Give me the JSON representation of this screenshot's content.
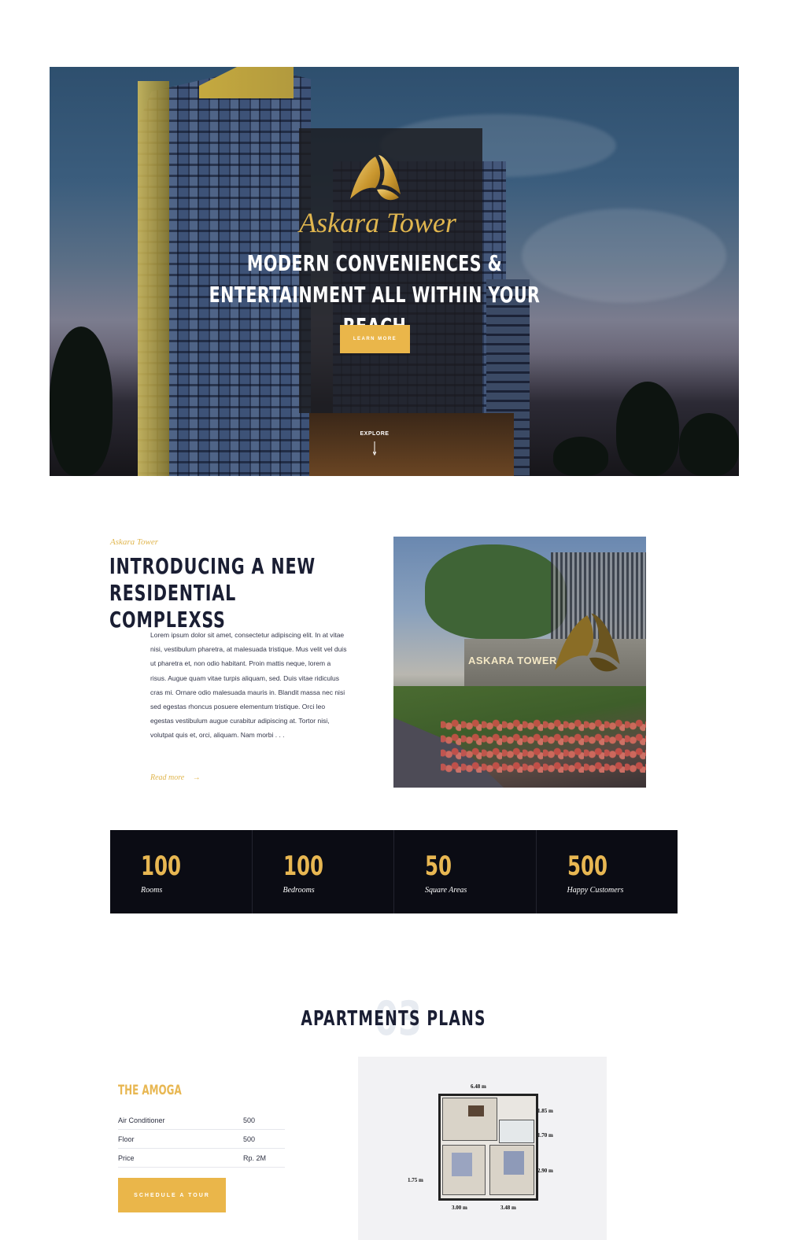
{
  "hero": {
    "brand": "Askara Tower",
    "headline": "MODERN CONVENIENCES & ENTERTAINMENT ALL WITHIN YOUR REACH",
    "cta_label": "LEARN MORE",
    "explore_label": "EXPLORE",
    "explore_icon": "arrow-down-icon"
  },
  "intro": {
    "eyebrow": "Askara Tower",
    "title": "INTRODUCING A NEW RESIDENTIAL COMPLEXSS",
    "body": "Lorem ipsum dolor sit amet, consectetur adipiscing elit. In at vitae nisi, vestibulum pharetra, at malesuada tristique. Mus velit vel duis ut pharetra et, non odio habitant. Proin mattis neque, lorem a risus. Augue quam vitae turpis aliquam, sed. Duis vitae ridiculus cras mi. Ornare odio malesuada mauris in. Blandit massa nec nisi sed egestas rhoncus posuere elementum tristique. Orci leo egestas vestibulum augue curabitur adipiscing at. Tortor nisi, volutpat quis et, orci, aliquam. Nam morbi . . .",
    "read_more": "Read more",
    "read_more_arrow": "→",
    "image_sign": "ASKARA TOWER"
  },
  "stats": [
    {
      "value": "100",
      "label": "Rooms"
    },
    {
      "value": "100",
      "label": "Bedrooms"
    },
    {
      "value": "50",
      "label": "Square Areas"
    },
    {
      "value": "500",
      "label": "Happy Customers"
    }
  ],
  "plans": {
    "bg_number": "03",
    "title": "APARTMENTS PLANS",
    "plan_name": "THE AMOGA",
    "specs": [
      {
        "label": "Air Conditioner",
        "value": "500"
      },
      {
        "label": "Floor",
        "value": "500"
      },
      {
        "label": "Price",
        "value": "Rp. 2M"
      }
    ],
    "cta_label": "SCHEDULE A TOUR",
    "dimensions": {
      "top": "6.48 m",
      "right1": "1.85 m",
      "right2": "1.70 m",
      "right3": "2.90 m",
      "left": "1.75 m",
      "bottom1": "3.00 m",
      "bottom2": "3.48 m"
    }
  },
  "colors": {
    "accent": "#eab64a",
    "dark": "#0b0c14",
    "heading": "#1a1e33"
  }
}
